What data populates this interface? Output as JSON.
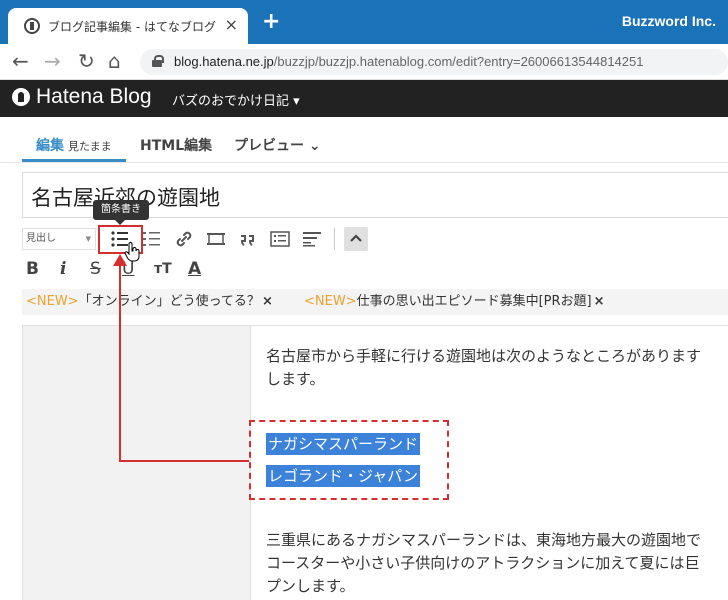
{
  "browser": {
    "tab_title": "ブログ記事編集 - はてなブログ",
    "tab_close": "×",
    "new_tab": "+",
    "brand": "Buzzword Inc.",
    "url_host": "blog.hatena.ne.jp",
    "url_path": "/buzzjp/buzzjp.hatenablog.com/edit?entry=26006613544814251",
    "nav": {
      "back": "←",
      "forward": "→",
      "reload": "↻",
      "home": "⌂"
    }
  },
  "hatena": {
    "title": "Hatena Blog",
    "blog_name": "バズのおでかけ日記 ▾"
  },
  "mode_tabs": {
    "edit": "編集",
    "edit_sub": "見たまま",
    "html": "HTML編集",
    "preview": "プレビュー ⌄"
  },
  "article": {
    "title": "名古屋近郊の遊園地"
  },
  "toolbar": {
    "tooltip": "箇条書き",
    "heading_select": "見出し",
    "heading_arrow": "▼",
    "format": {
      "bold": "B",
      "italic": "i",
      "strike": "S",
      "underline": "U",
      "size": "тT",
      "color": "A"
    }
  },
  "news": [
    {
      "tag": "<NEW>",
      "text": "「オンライン」どう使ってる？",
      "close": "×"
    },
    {
      "tag": "<NEW>",
      "text": "仕事の思い出エピソード募集中[PRお題]",
      "close": "×"
    }
  ],
  "body": {
    "p1_line1": "名古屋市から手軽に行ける遊園地は次のようなところがあります",
    "p1_line2": "します。",
    "sel1": "ナガシマスパーランド",
    "sel2": "レゴランド・ジャパン",
    "p2_line1": "三重県にあるナガシマスパーランドは、東海地方最大の遊園地で",
    "p2_line2": "コースターや小さい子供向けのアトラクションに加えて夏には巨",
    "p2_line3": "プンします。"
  },
  "colors": {
    "browser_blue": "#1a73b8",
    "hatena_bar": "#222222",
    "accent": "#3a8ec8",
    "selection": "#3b82d8",
    "annotation_red": "#d32f2f",
    "new_tag": "#f0a030"
  }
}
